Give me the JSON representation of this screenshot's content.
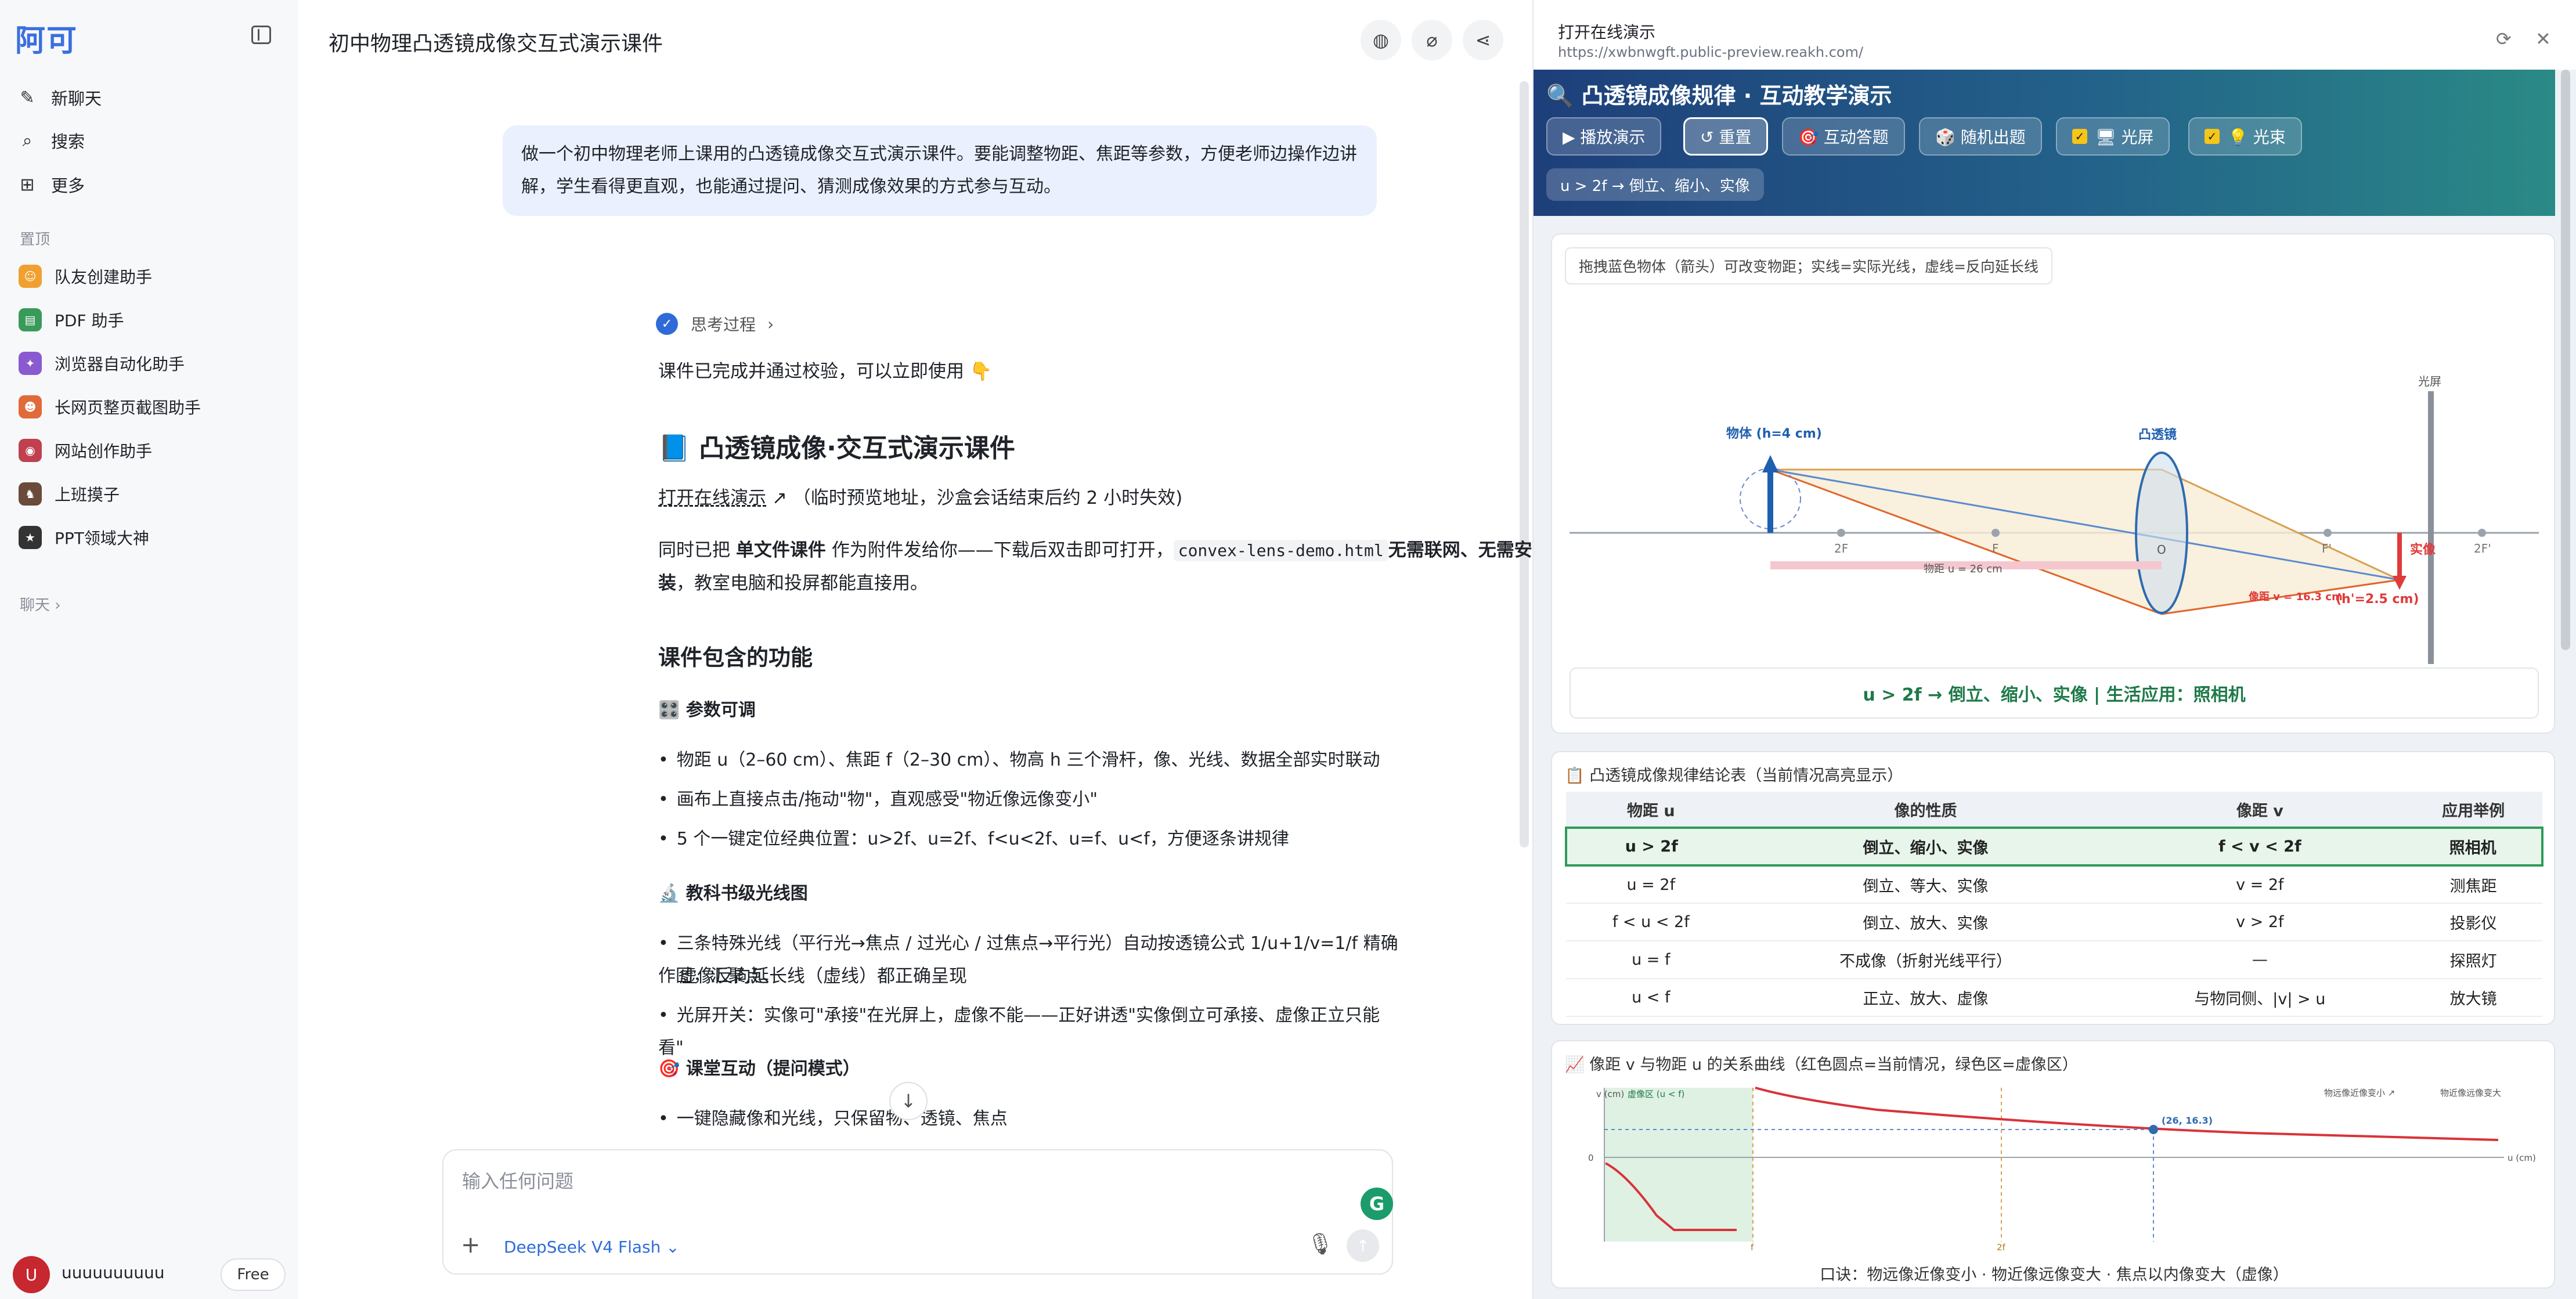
{
  "sidebar": {
    "logo": "阿可",
    "nav": [
      {
        "label": "新聊天",
        "icon": "edit-icon"
      },
      {
        "label": "搜索",
        "icon": "search-icon"
      },
      {
        "label": "更多",
        "icon": "grid-icon"
      }
    ],
    "pinned_label": "置顶",
    "pinned": [
      {
        "label": "队友创建助手",
        "color": "#f0a030"
      },
      {
        "label": "PDF 助手",
        "color": "#3a9a5a"
      },
      {
        "label": "浏览器自动化助手",
        "color": "#8a5ad0"
      },
      {
        "label": "长网页整页截图助手",
        "color": "#e06a3a"
      },
      {
        "label": "网站创作助手",
        "color": "#c04050"
      },
      {
        "label": "上班摸子",
        "color": "#6a4a3a"
      },
      {
        "label": "PPT领域大神",
        "color": "#333333"
      }
    ],
    "chats_label": "聊天",
    "user": {
      "initial": "U",
      "name": "uuuuuuuuuu",
      "plan": "Free"
    }
  },
  "chat": {
    "title": "初中物理凸透镜成像交互式演示课件",
    "user_message": "做一个初中物理老师上课用的凸透镜成像交互式演示课件。要能调整物距、焦距等参数，方便老师边操作边讲解，学生看得更直观，也能通过提问、猜测成像效果的方式参与互动。",
    "thinking_label": "思考过程",
    "done_line": "课件已完成并通过校验，可以立即使用 👇",
    "heading": "📘 凸透镜成像·交互式演示课件",
    "open_link": "打开在线演示",
    "open_note": "（临时预览地址，沙盒会话结束后约 2 小时失效)",
    "attach_p1": "同时已把 ",
    "attach_bold1": "单文件课件",
    "attach_code": "convex-lens-demo.html",
    "attach_p2": " 作为附件发给你——下载后双击即可打开，",
    "attach_bold2": "无需联网、无需安装",
    "attach_p3": "，教室电脑和投屏都能直接用。",
    "features_heading": "课件包含的功能",
    "sec1": "🎛️ 参数可调",
    "sec1_items": [
      "物距 u（2–60 cm）、焦距 f（2–30 cm）、物高 h 三个滑杆，像、光线、数据全部实时联动",
      "画布上直接点击/拖动\"物\"，直观感受\"物近像远像变小\"",
      "5 个一键定位经典位置：u>2f、u=2f、f<u<2f、u=f、u<f，方便逐条讲规律"
    ],
    "sec2": "🔬 教科书级光线图",
    "sec2_items": [
      "三条特殊光线（平行光→焦点 / 过光心 / 过焦点→平行光）自动按透镜公式 1/u+1/v=1/f 精确作图，汇聚点、",
      "虚像反向延长线（虚线）都正确呈现",
      "光屏开关：实像可\"承接\"在光屏上，虚像不能——正好讲透\"实像倒立可承接、虚像正立只能看\""
    ],
    "sec3": "🎯 课堂互动（提问模式）",
    "sec3_items": [
      "一键隐藏像和光线，只保留物、透镜、焦点"
    ],
    "composer_placeholder": "输入任何问题",
    "model_name": "DeepSeek V4 Flash"
  },
  "preview": {
    "title": "打开在线演示",
    "url": "https://xwbnwgft.public-preview.reakh.com/",
    "app_title": "🔍 凸透镜成像规律 · 互动教学演示",
    "buttons": [
      "▶ 播放演示",
      "↺ 重置",
      "🎯 互动答题",
      "🎲 随机出题",
      "🖥 光屏",
      "💡 光束"
    ],
    "state_chip": "u > 2f → 倒立、缩小、实像",
    "hint": "拖拽蓝色物体（箭头）可改变物距；实线=实际光线，虚线=反向延长线",
    "ray": {
      "object_label": "物体 (h=4 cm)",
      "lens_label": "凸透镜",
      "screen_label": "光屏",
      "image_label": "实像",
      "f_left": "2F",
      "f_left2": "F",
      "o_label": "O",
      "f_right": "F'",
      "f_right2": "2F'",
      "u_label": "物距 u = 26 cm",
      "v_label": "像距 v = 16.3 cm",
      "h_label": "(h'=2.5 cm)",
      "u": 26,
      "v": 16.3,
      "f": 10,
      "h": 4,
      "h_img": 2.5
    },
    "rule_banner": "u > 2f   →   倒立、缩小、实像    |    生活应用：照相机",
    "table_title": "📋 凸透镜成像规律结论表（当前情况高亮显示）",
    "table_headers": [
      "物距 u",
      "像的性质",
      "像距 v",
      "应用举例"
    ],
    "table_rows": [
      [
        "u > 2f",
        "倒立、缩小、实像",
        "f < v < 2f",
        "照相机"
      ],
      [
        "u = 2f",
        "倒立、等大、实像",
        "v = 2f",
        "测焦距"
      ],
      [
        "f < u < 2f",
        "倒立、放大、实像",
        "v > 2f",
        "投影仪"
      ],
      [
        "u = f",
        "不成像（折射光线平行）",
        "—",
        "探照灯"
      ],
      [
        "u < f",
        "正立、放大、虚像",
        "与物同侧、|v| > u",
        "放大镜"
      ]
    ],
    "graph_title": "📈 像距 v 与物距 u 的关系曲线（红色圆点=当前情况，绿色区=虚像区）",
    "graph": {
      "ylabel": "v (cm)",
      "virtual_label": "虚像区 (u < f)",
      "zero_label": "0",
      "xlabel": "u (cm)",
      "f_tick": "f",
      "twof_tick": "2f",
      "point_label": "(26, 16.3)",
      "legend1": "物远像近像变小 ↗",
      "legend2": "物近像远像变大",
      "mnemonic": "口诀：物远像近像变小 · 物近像远像变大 · 焦点以内像变大（虚像）"
    },
    "colors": {
      "accent": "#2f6bd8",
      "real_ray": "#e0652a",
      "virtual": "#1f7a4a"
    }
  }
}
